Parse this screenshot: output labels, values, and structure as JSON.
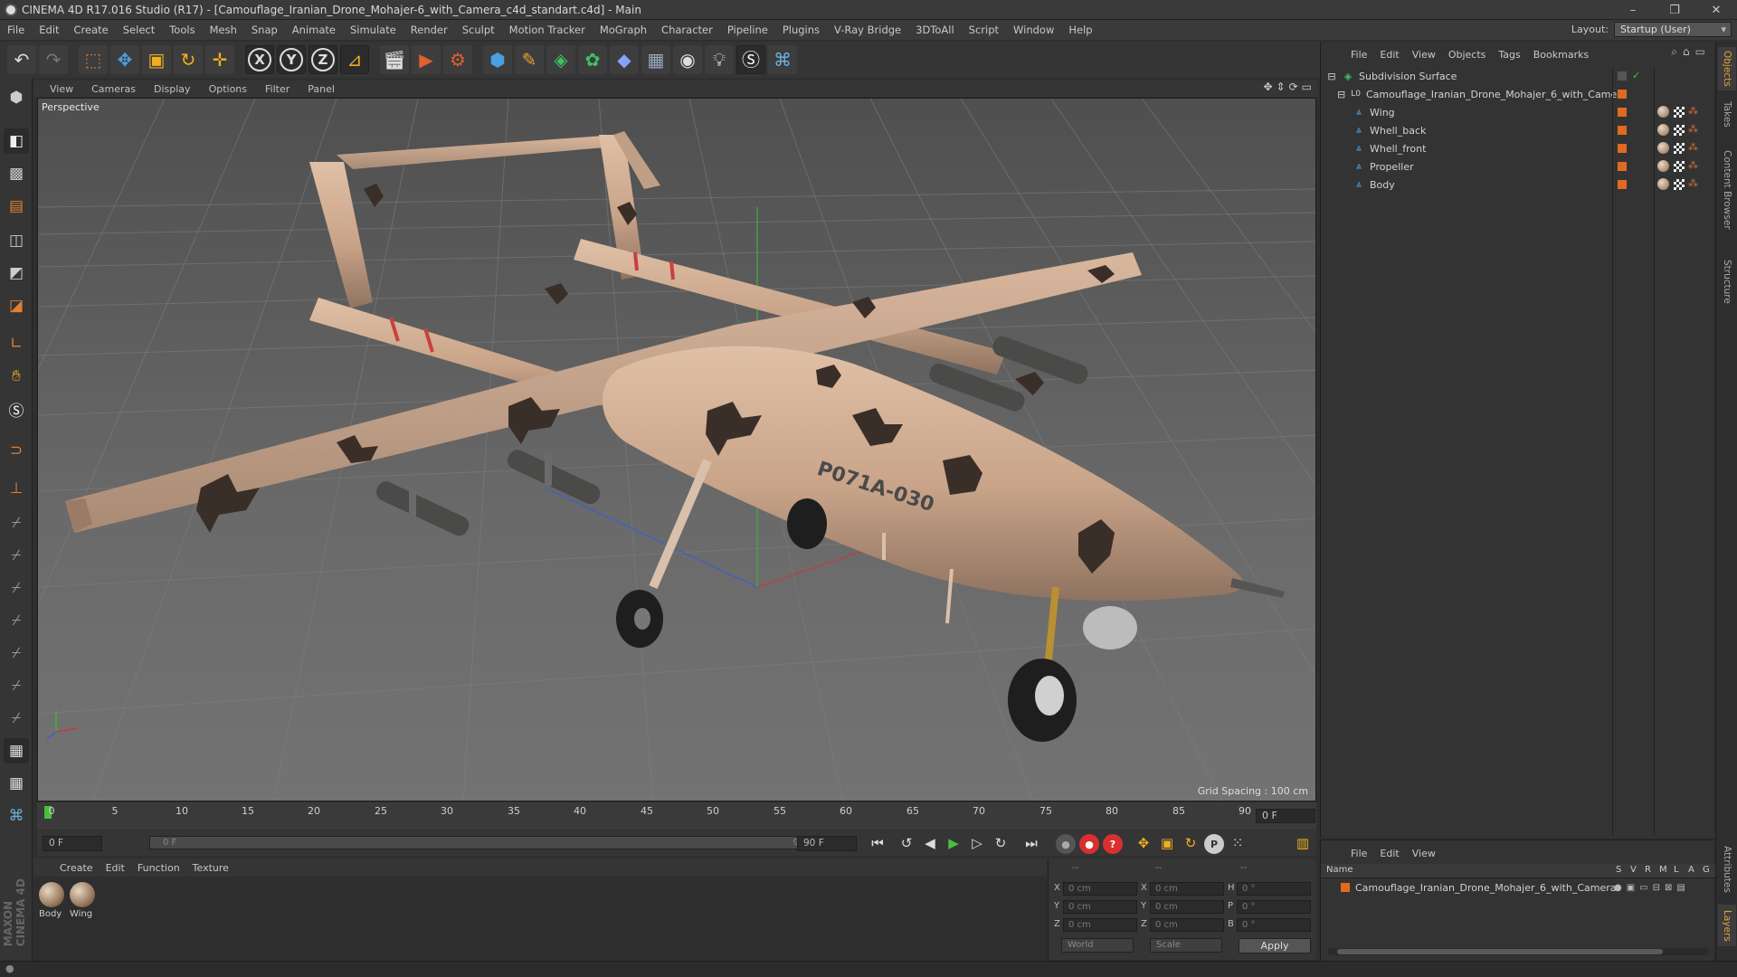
{
  "window": {
    "title": "CINEMA 4D R17.016 Studio (R17) - [Camouflage_Iranian_Drone_Mohajer-6_with_Camera_c4d_standart.c4d] - Main",
    "controls": [
      "–",
      "❐",
      "✕"
    ]
  },
  "menubar": {
    "items": [
      "File",
      "Edit",
      "Create",
      "Select",
      "Tools",
      "Mesh",
      "Snap",
      "Animate",
      "Simulate",
      "Render",
      "Sculpt",
      "Motion Tracker",
      "MoGraph",
      "Character",
      "Pipeline",
      "Plugins",
      "V-Ray Bridge",
      "3DToAll",
      "Script",
      "Window",
      "Help"
    ],
    "layout_label": "Layout:",
    "layout_value": "Startup (User)"
  },
  "toolbar": {
    "axis_x": "X",
    "axis_y": "Y",
    "axis_z": "Z"
  },
  "viewport": {
    "menu": [
      "View",
      "Cameras",
      "Display",
      "Options",
      "Filter",
      "Panel"
    ],
    "label": "Perspective",
    "grid_spacing": "Grid Spacing : 100 cm",
    "model_text": "P071A-030"
  },
  "timeline": {
    "ticks": [
      "0",
      "5",
      "10",
      "15",
      "20",
      "25",
      "30",
      "35",
      "40",
      "45",
      "50",
      "55",
      "60",
      "65",
      "70",
      "75",
      "80",
      "85",
      "90"
    ],
    "current_frame": "0 F"
  },
  "transport": {
    "start_field": "0 F",
    "range_start": "0 F",
    "range_end": "90 F",
    "end_field": "90 F"
  },
  "material_manager": {
    "menu": [
      "Create",
      "Edit",
      "Function",
      "Texture"
    ],
    "materials": [
      "Body",
      "Wing"
    ]
  },
  "coordinates": {
    "col_headers": [
      "--",
      "--",
      "--"
    ],
    "rows": [
      {
        "pos_label": "X",
        "pos": "0 cm",
        "size_label": "X",
        "size": "0 cm",
        "rot_label": "H",
        "rot": "0 °"
      },
      {
        "pos_label": "Y",
        "pos": "0 cm",
        "size_label": "Y",
        "size": "0 cm",
        "rot_label": "P",
        "rot": "0 °"
      },
      {
        "pos_label": "Z",
        "pos": "0 cm",
        "size_label": "Z",
        "size": "0 cm",
        "rot_label": "B",
        "rot": "0 °"
      }
    ],
    "space": "World",
    "mode": "Scale",
    "apply": "Apply"
  },
  "object_manager": {
    "menu": [
      "File",
      "Edit",
      "View",
      "Objects",
      "Tags",
      "Bookmarks"
    ],
    "objects": [
      {
        "name": "Subdivision Surface",
        "level": 0
      },
      {
        "name": "Camouflage_Iranian_Drone_Mohajer_6_with_Camera",
        "level": 1
      },
      {
        "name": "Wing",
        "level": 2
      },
      {
        "name": "Whell_back",
        "level": 2
      },
      {
        "name": "Whell_front",
        "level": 2
      },
      {
        "name": "Propeller",
        "level": 2
      },
      {
        "name": "Body",
        "level": 2
      }
    ]
  },
  "side_tabs": [
    "Objects",
    "Takes",
    "Content Browser",
    "Structure",
    "Attributes",
    "Layers"
  ],
  "layer_manager": {
    "menu": [
      "File",
      "Edit",
      "View"
    ],
    "columns": [
      "Name",
      "S",
      "V",
      "R",
      "M",
      "L",
      "A",
      "G"
    ],
    "layers": [
      "Camouflage_Iranian_Drone_Mohajer_6_with_Camera"
    ]
  },
  "colors": {
    "accent_orange": "#e06a20",
    "play_green": "#45c040",
    "record_red": "#d83030",
    "drone_tan": "#c9a489",
    "camo_dark": "#3a2e28"
  }
}
